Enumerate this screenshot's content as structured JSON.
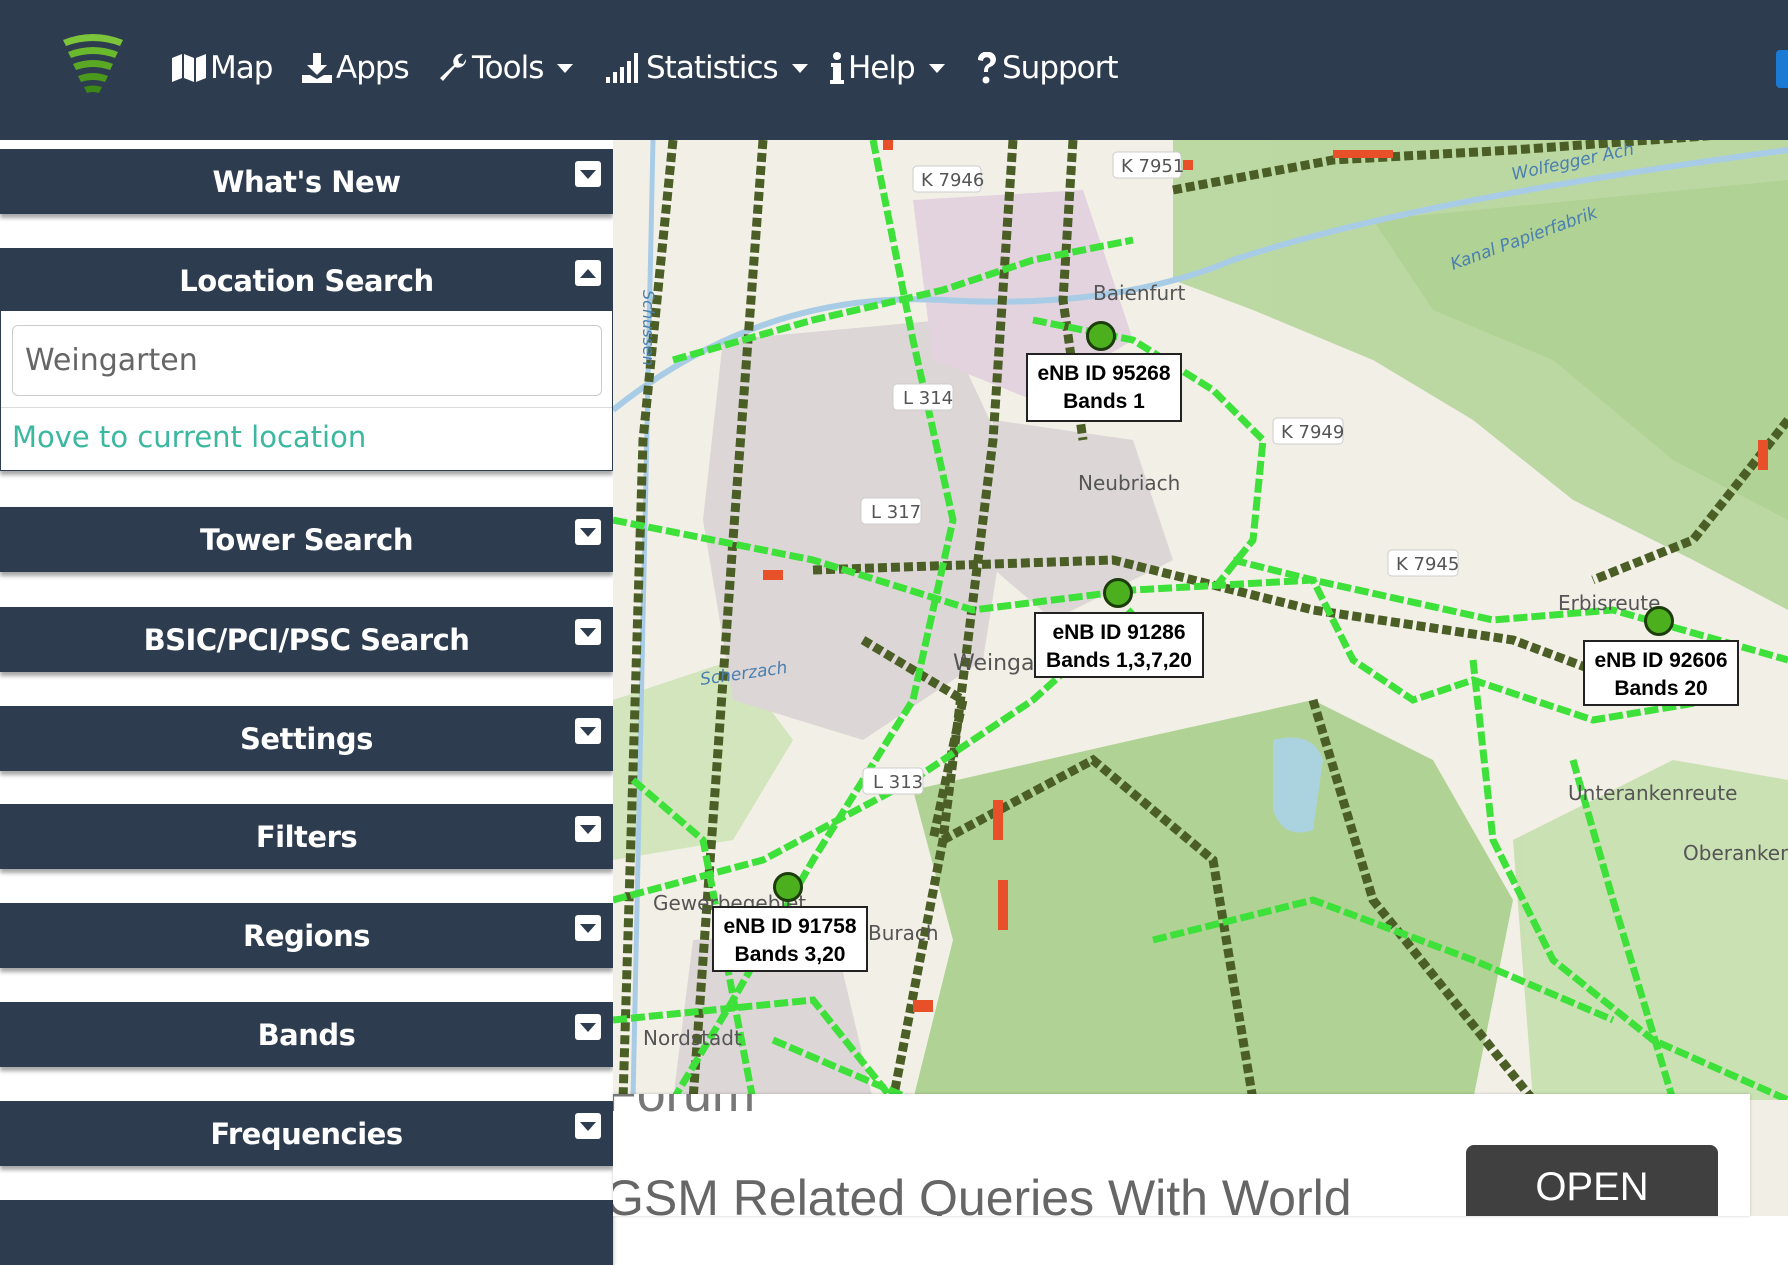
{
  "header": {
    "nav": [
      {
        "label": "Map",
        "icon": "map-icon"
      },
      {
        "label": "Apps",
        "icon": "download-icon"
      },
      {
        "label": "Tools",
        "icon": "wrench-icon",
        "dropdown": true
      },
      {
        "label": "Statistics",
        "icon": "signal-bars-icon",
        "dropdown": true
      },
      {
        "label": "Help",
        "icon": "info-icon",
        "dropdown": true
      },
      {
        "label": "Support",
        "icon": "question-icon"
      }
    ]
  },
  "sidebar": {
    "panels": [
      "What's New",
      "Location Search",
      "Tower Search",
      "BSIC/PCI/PSC Search",
      "Settings",
      "Filters",
      "Regions",
      "Bands",
      "Frequencies"
    ],
    "location_search": {
      "value": "Weingarten",
      "move_link": "Move to current location"
    }
  },
  "map": {
    "towers": [
      {
        "id": "eNB ID 95268",
        "bands": "Bands 1"
      },
      {
        "id": "eNB ID 91286",
        "bands": "Bands 1,3,7,20"
      },
      {
        "id": "eNB ID 92606",
        "bands": "Bands 20"
      },
      {
        "id": "eNB ID 91758",
        "bands": "Bands 3,20"
      }
    ],
    "labels": [
      "K 7946",
      "K 7951",
      "L 314",
      "L 317",
      "L 313",
      "K 7949",
      "K 7945",
      "Baienfurt",
      "Neubriach",
      "Weingarten",
      "Erbisreute",
      "Unterankenreute",
      "Oberankenreute",
      "Burach",
      "Nordstadt",
      "Gewerbegebiet",
      "Scherzach",
      "Wolfegger Ach",
      "Kanal Papierfabrik",
      "Schussen"
    ],
    "colors": {
      "good": "#33e033",
      "mid": "#4a5e26",
      "bad": "#e8502a"
    }
  },
  "ad": {
    "title": "Forum",
    "text": "GSM Related Queries With World",
    "button": "OPEN"
  }
}
